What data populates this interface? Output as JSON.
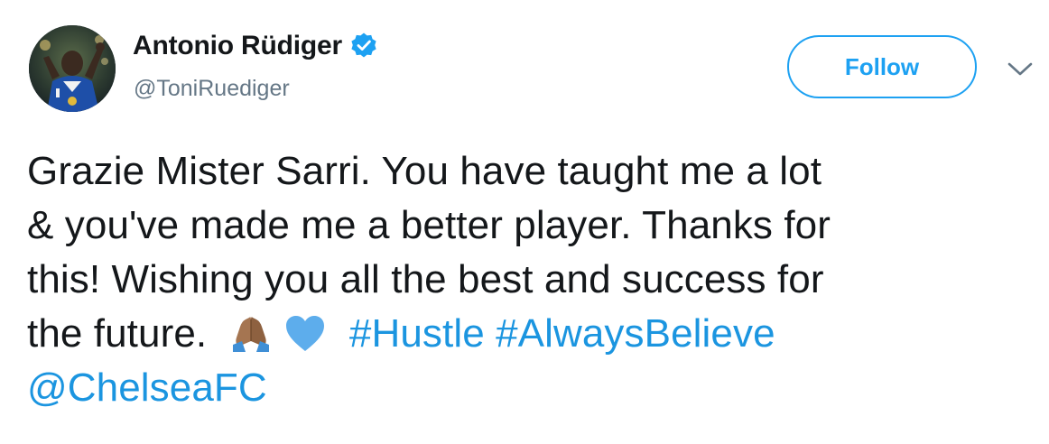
{
  "user": {
    "display_name": "Antonio Rüdiger",
    "handle": "@ToniRuediger",
    "verified": true
  },
  "actions": {
    "follow_label": "Follow",
    "more_icon": "chevron-down-icon"
  },
  "tweet": {
    "line1": "Grazie Mister Sarri. You have taught me a lot",
    "line2": "& you've made me a better player. Thanks for",
    "line3": "this! Wishing you all the best and success for",
    "line4_text": "the future.",
    "emoji": [
      "folded-hands-icon",
      "blue-heart-icon"
    ],
    "hashtags": [
      "#Hustle",
      "#AlwaysBelieve"
    ],
    "mention": "@ChelseaFC"
  },
  "colors": {
    "accent": "#1da1f2",
    "link": "#1b95e0",
    "text": "#14171a",
    "muted": "#657786",
    "heart": "#5dadec"
  }
}
